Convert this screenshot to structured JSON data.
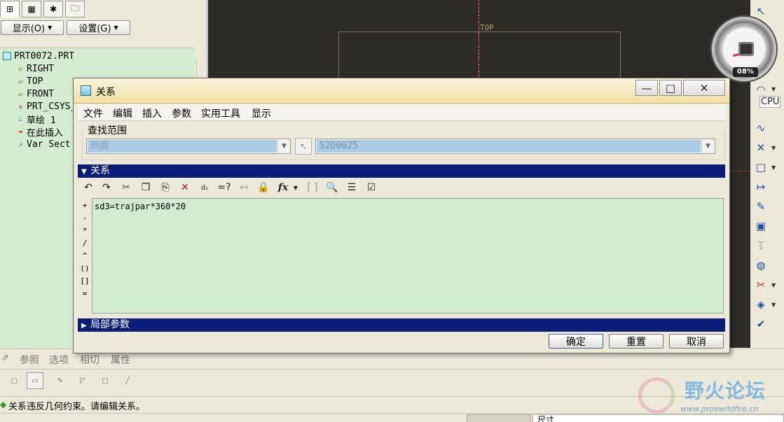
{
  "left_panel": {
    "tabs": [
      "model-tree",
      "layers",
      "favorites",
      "folders"
    ],
    "display_label": "显示(O)",
    "settings_label": "设置(G)",
    "tree": [
      {
        "icon": "part-icon",
        "label": "PRT0072.PRT"
      },
      {
        "icon": "datum-plane-icon",
        "label": "RIGHT"
      },
      {
        "icon": "datum-plane-icon",
        "label": "TOP"
      },
      {
        "icon": "datum-plane-icon",
        "label": "FRONT"
      },
      {
        "icon": "csys-icon",
        "label": "PRT_CSYS_DEF"
      },
      {
        "icon": "sketch-icon",
        "label": "草绘 1"
      },
      {
        "icon": "insert-here-icon",
        "label": "在此插入"
      },
      {
        "icon": "var-sect-sweep-icon",
        "label": "Var Sect Sweep"
      }
    ]
  },
  "graphics": {
    "view_label": "TOP",
    "cpu_label": "CPU",
    "cpu_percent": "08%"
  },
  "dialog": {
    "title": "关系",
    "menu": [
      "文件",
      "编辑",
      "插入",
      "参数",
      "实用工具",
      "显示"
    ],
    "scope_label": "查找范围",
    "scope_value": "剖面",
    "feature_value": "S2D0025",
    "relations_label": "关系",
    "local_params_label": "局部参数",
    "operators": [
      "+",
      "-",
      "*",
      "/",
      "^",
      "()",
      "[]",
      "="
    ],
    "relations_text": "sd3=trajpar*360*20",
    "buttons": {
      "ok": "确定",
      "reset": "重置",
      "cancel": "取消"
    },
    "window_controls": {
      "minimize": "—",
      "maximize": "□",
      "close": "✕"
    }
  },
  "dashboard": {
    "tabs": [
      "参照",
      "选项",
      "相切",
      "属性"
    ]
  },
  "message": "关系违反几何约束。请编辑关系。",
  "status": {
    "filter": "尺寸"
  },
  "watermark": {
    "title": "野火论坛",
    "url": "www.proewildfire.cn"
  }
}
